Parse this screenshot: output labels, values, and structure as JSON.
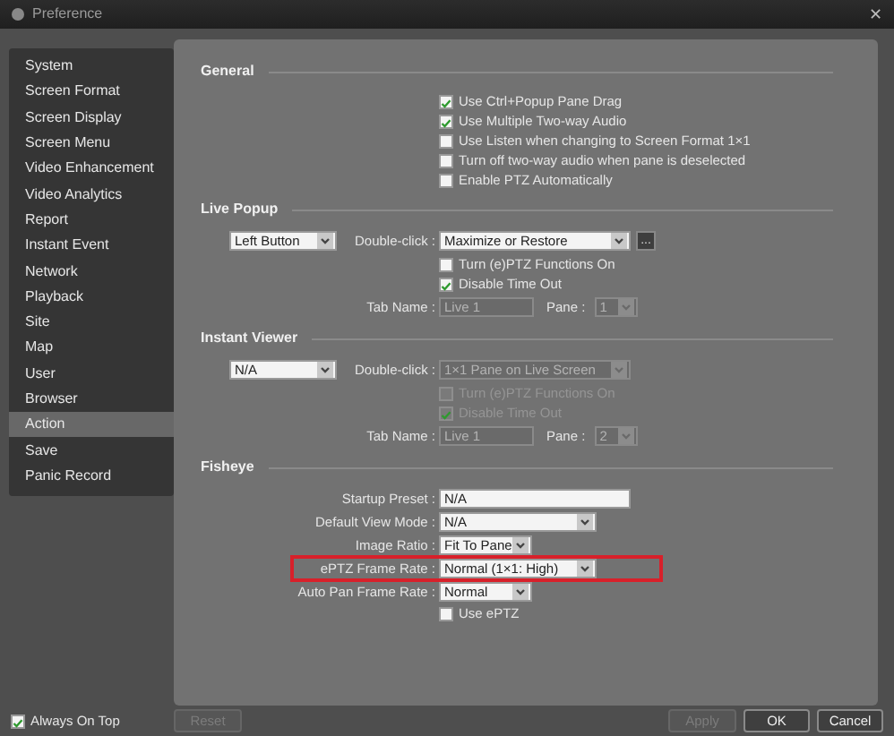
{
  "window": {
    "title": "Preference",
    "close_glyph": "✕"
  },
  "sidebar": {
    "items": [
      {
        "label": "System",
        "selected": false
      },
      {
        "label": "Screen Format",
        "selected": false
      },
      {
        "label": "Screen Display",
        "selected": false
      },
      {
        "label": "Screen Menu",
        "selected": false
      },
      {
        "label": "Video Enhancement",
        "selected": false
      },
      {
        "label": "Video Analytics",
        "selected": false
      },
      {
        "label": "Report",
        "selected": false
      },
      {
        "label": "Instant Event",
        "selected": false
      },
      {
        "label": "Network",
        "selected": false
      },
      {
        "label": "Playback",
        "selected": false
      },
      {
        "label": "Site",
        "selected": false
      },
      {
        "label": "Map",
        "selected": false
      },
      {
        "label": "User",
        "selected": false
      },
      {
        "label": "Browser",
        "selected": false
      },
      {
        "label": "Action",
        "selected": true
      },
      {
        "label": "Save",
        "selected": false
      },
      {
        "label": "Panic Record",
        "selected": false
      }
    ]
  },
  "sections": [
    {
      "title": "General",
      "rows": [
        {
          "kind": "checkbox",
          "label": "Use Ctrl+Popup Pane Drag",
          "checked": true,
          "disabled": false
        },
        {
          "kind": "checkbox",
          "label": "Use Multiple Two-way Audio",
          "checked": true,
          "disabled": false
        },
        {
          "kind": "checkbox",
          "label": "Use Listen when changing to Screen Format 1×1",
          "checked": false,
          "disabled": false
        },
        {
          "kind": "checkbox",
          "label": "Turn off two-way audio when pane is deselected",
          "checked": false,
          "disabled": false
        },
        {
          "kind": "checkbox",
          "label": "Enable PTZ Automatically",
          "checked": false,
          "disabled": false
        }
      ]
    },
    {
      "title": "Live Popup",
      "rows": [
        {
          "kind": "double_click",
          "mode": "Left Button",
          "label": "Double-click :",
          "value": "Maximize or Restore",
          "disabled": false,
          "more_button": "..."
        },
        {
          "kind": "checkbox",
          "label": "Turn (e)PTZ Functions On",
          "checked": false,
          "disabled": false
        },
        {
          "kind": "checkbox",
          "label": "Disable Time Out",
          "checked": true,
          "disabled": false
        },
        {
          "kind": "tab_name",
          "label": "Tab Name :",
          "value": "Live 1",
          "pane_label": "Pane :",
          "pane_value": "1",
          "disabled": true
        }
      ]
    },
    {
      "title": "Instant Viewer",
      "rows": [
        {
          "kind": "double_click",
          "mode": "N/A",
          "label": "Double-click :",
          "value": "1×1 Pane on Live Screen",
          "disabled": true
        },
        {
          "kind": "checkbox",
          "label": "Turn (e)PTZ Functions On",
          "checked": false,
          "disabled": true
        },
        {
          "kind": "checkbox",
          "label": "Disable Time Out",
          "checked": true,
          "disabled": true
        },
        {
          "kind": "tab_name",
          "label": "Tab Name :",
          "value": "Live 1",
          "pane_label": "Pane :",
          "pane_value": "2",
          "disabled": true
        }
      ]
    },
    {
      "title": "Fisheye",
      "rows": [
        {
          "kind": "text",
          "label": "Startup Preset :",
          "value": "N/A",
          "highlighted": false
        },
        {
          "kind": "select_long",
          "label": "Default View Mode :",
          "value": "N/A",
          "highlighted": false
        },
        {
          "kind": "select_short",
          "label": "Image Ratio :",
          "value": "Fit To Pane",
          "highlighted": false
        },
        {
          "kind": "select_long",
          "label": "ePTZ Frame Rate :",
          "value": "Normal (1×1: High)",
          "highlighted": true
        },
        {
          "kind": "select_short",
          "label": "Auto Pan Frame Rate :",
          "value": "Normal",
          "highlighted": false
        },
        {
          "kind": "checkbox",
          "label": "Use ePTZ",
          "checked": false,
          "disabled": false
        }
      ]
    }
  ],
  "always_on_top": {
    "label": "Always On Top",
    "checked": true
  },
  "buttons": [
    {
      "label": "Reset",
      "disabled": true
    },
    {
      "label": "Apply",
      "disabled": true
    },
    {
      "label": "OK",
      "disabled": false
    },
    {
      "label": "Cancel",
      "disabled": false
    }
  ]
}
